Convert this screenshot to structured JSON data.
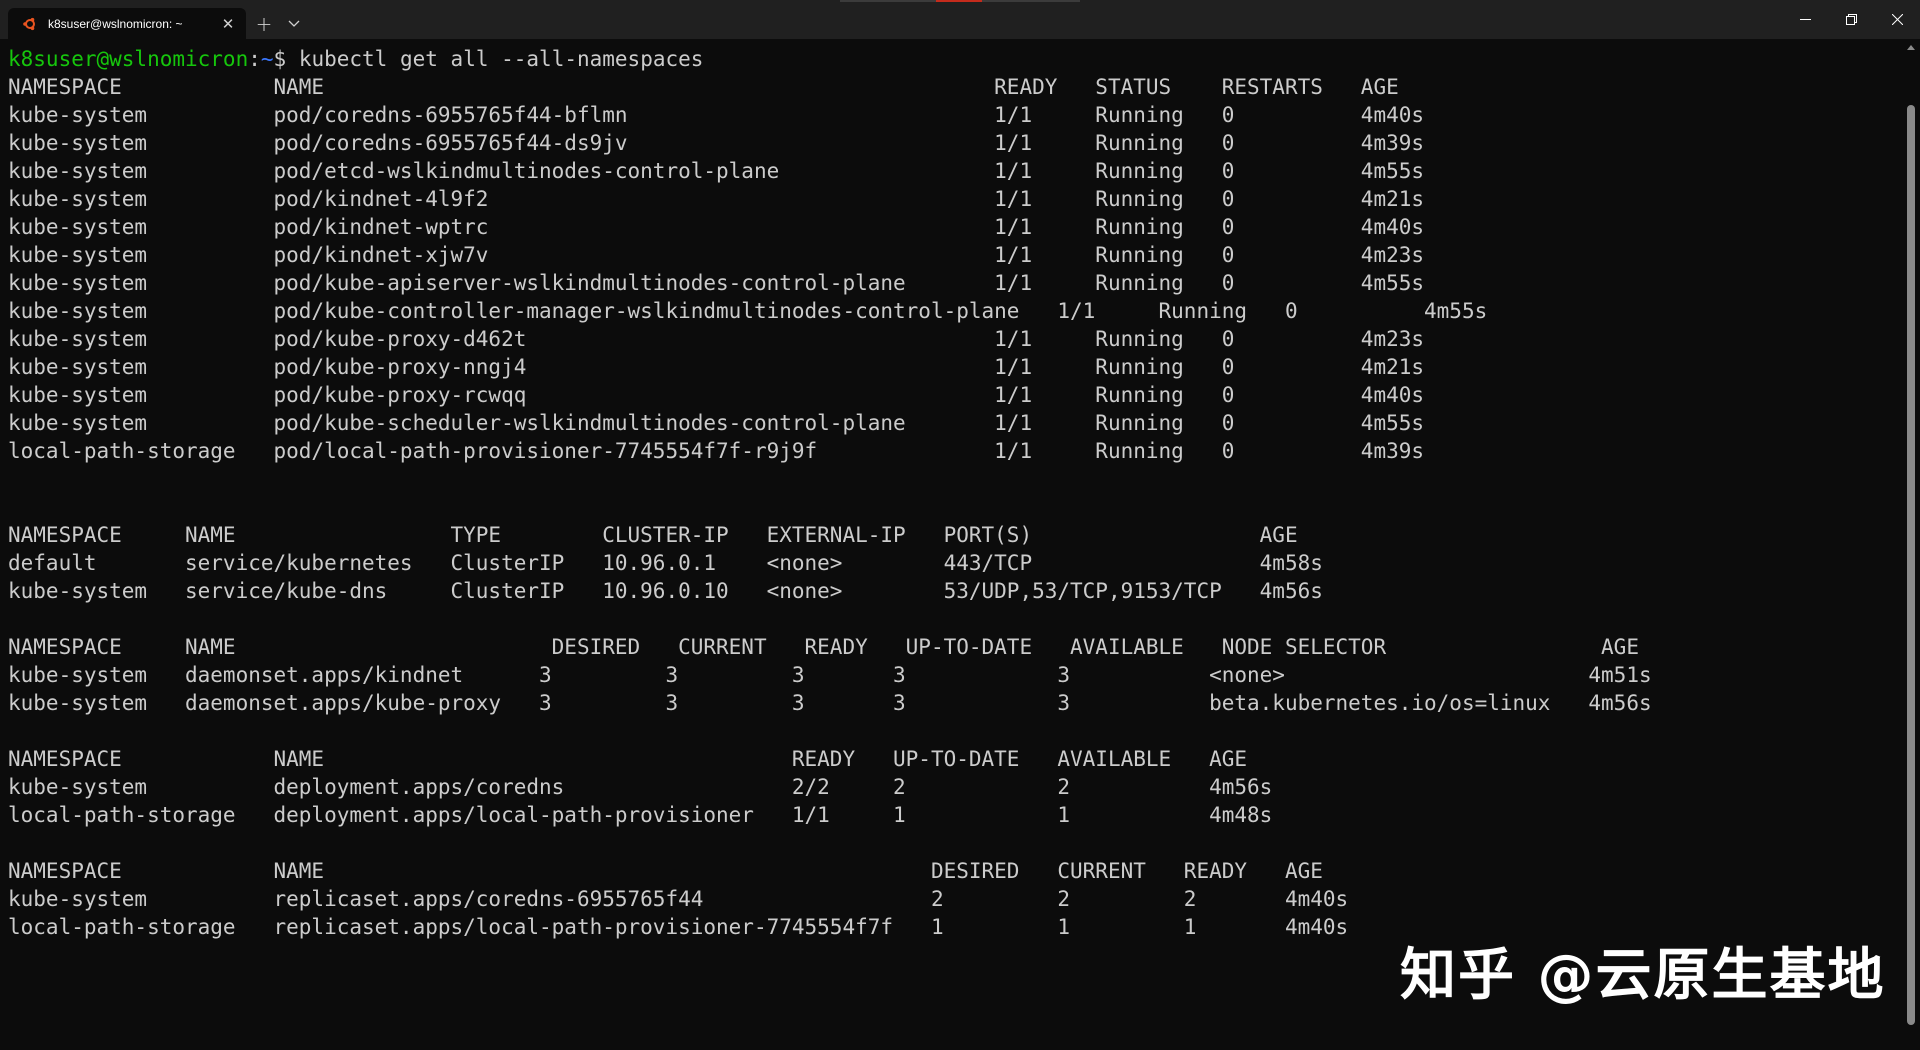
{
  "window": {
    "tab_title": "k8suser@wslnomicron: ~",
    "tab_icon": "ubuntu-icon",
    "new_tab_label": "+",
    "close_tab_label": "✕",
    "accent": "#c42b1c"
  },
  "terminal": {
    "prompt_user_host": "k8suser@wslnomicron",
    "prompt_sep": ":",
    "prompt_path": "~",
    "prompt_symbol": "$ ",
    "command": "kubectl get all --all-namespaces",
    "user_color": "#16c60c",
    "path_color": "#3b78ff",
    "pods": {
      "header": "NAMESPACE            NAME                                                     READY   STATUS    RESTARTS   AGE",
      "rows": [
        "kube-system          pod/coredns-6955765f44-bflmn                             1/1     Running   0          4m40s",
        "kube-system          pod/coredns-6955765f44-ds9jv                             1/1     Running   0          4m39s",
        "kube-system          pod/etcd-wslkindmultinodes-control-plane                 1/1     Running   0          4m55s",
        "kube-system          pod/kindnet-4l9f2                                        1/1     Running   0          4m21s",
        "kube-system          pod/kindnet-wptrc                                        1/1     Running   0          4m40s",
        "kube-system          pod/kindnet-xjw7v                                        1/1     Running   0          4m23s",
        "kube-system          pod/kube-apiserver-wslkindmultinodes-control-plane       1/1     Running   0          4m55s",
        "kube-system          pod/kube-controller-manager-wslkindmultinodes-control-plane   1/1     Running   0          4m55s",
        "kube-system          pod/kube-proxy-d462t                                     1/1     Running   0          4m23s",
        "kube-system          pod/kube-proxy-nngj4                                     1/1     Running   0          4m21s",
        "kube-system          pod/kube-proxy-rcwqq                                     1/1     Running   0          4m40s",
        "kube-system          pod/kube-scheduler-wslkindmultinodes-control-plane       1/1     Running   0          4m55s",
        "local-path-storage   pod/local-path-provisioner-7745554f7f-r9j9f              1/1     Running   0          4m39s"
      ]
    },
    "services": {
      "header": "NAMESPACE     NAME                 TYPE        CLUSTER-IP   EXTERNAL-IP   PORT(S)                  AGE",
      "rows": [
        "default       service/kubernetes   ClusterIP   10.96.0.1    <none>        443/TCP                  4m58s",
        "kube-system   service/kube-dns     ClusterIP   10.96.0.10   <none>        53/UDP,53/TCP,9153/TCP   4m56s"
      ]
    },
    "daemonsets": {
      "header": "NAMESPACE     NAME                         DESIRED   CURRENT   READY   UP-TO-DATE   AVAILABLE   NODE SELECTOR                 AGE",
      "rows": [
        "kube-system   daemonset.apps/kindnet      3         3         3       3            3           <none>                        4m51s",
        "kube-system   daemonset.apps/kube-proxy   3         3         3       3            3           beta.kubernetes.io/os=linux   4m56s"
      ]
    },
    "deployments": {
      "header": "NAMESPACE            NAME                                     READY   UP-TO-DATE   AVAILABLE   AGE",
      "rows": [
        "kube-system          deployment.apps/coredns                  2/2     2            2           4m56s",
        "local-path-storage   deployment.apps/local-path-provisioner   1/1     1            1           4m48s"
      ]
    },
    "replicasets": {
      "header": "NAMESPACE            NAME                                                DESIRED   CURRENT   READY   AGE",
      "rows": [
        "kube-system          replicaset.apps/coredns-6955765f44                  2         2         2       4m40s",
        "local-path-storage   replicaset.apps/local-path-provisioner-7745554f7f   1         1         1       4m40s"
      ]
    }
  },
  "watermark": "知乎 @云原生基地"
}
